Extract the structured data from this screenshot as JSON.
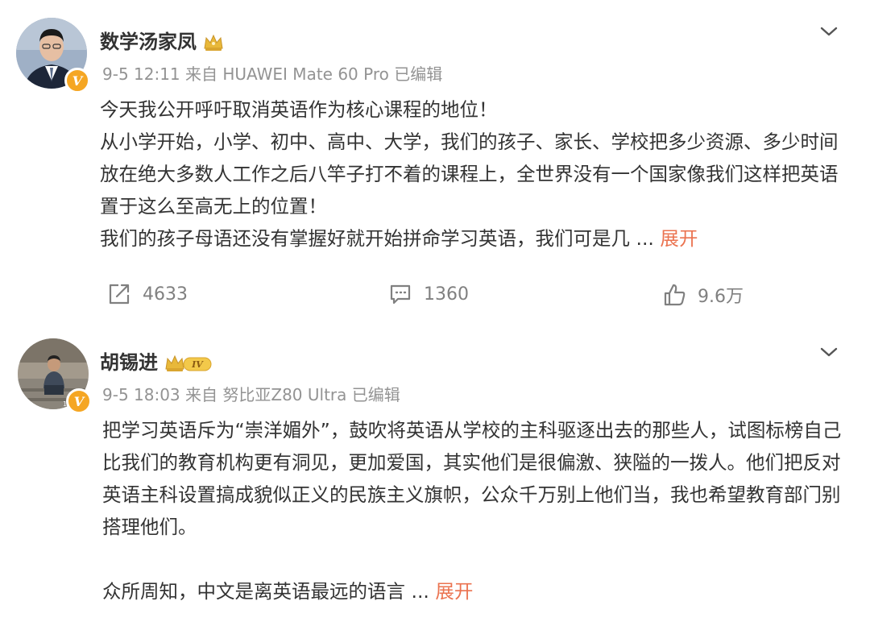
{
  "posts": [
    {
      "author": "数学汤家凤",
      "meta": "9-5 12:11 来自 HUAWEI Mate 60 Pro 已编辑",
      "paragraphs": [
        "今天我公开呼吁取消英语作为核心课程的地位！",
        "从小学开始，小学、初中、高中、大学，我们的孩子、家长、学校把多少资源、多少时间放在绝大多数人工作之后八竿子打不着的课程上，全世界没有一个国家像我们这样把英语置于这么至高无上的位置！",
        "我们的孩子母语还没有掌握好就开始拼命学习英语，我们可是几 ..."
      ],
      "expand_label": "展开",
      "verified_icon": "v-verified-badge",
      "crown_icon": "gold-crown-icon",
      "actions": {
        "repost_count": "4633",
        "comment_count": "1360",
        "like_count": "9.6万"
      }
    },
    {
      "author": "胡锡进",
      "meta": "9-5 18:03 来自 努比亚Z80 Ultra 已编辑",
      "level_badge": "IV",
      "paragraphs": [
        "把学习英语斥为“崇洋媚外”，鼓吹将英语从学校的主科驱逐出去的那些人，试图标榜自己比我们的教育机构更有洞见，更加爱国，其实他们是很偏激、狭隘的一拨人。他们把反对英语主科设置搞成貌似正义的民族主义旗帜，公众千万别上他们当，我也希望教育部门别搭理他们。",
        "众所周知，中文是离英语最远的语言 ..."
      ],
      "expand_label": "展开",
      "verified_icon": "v-verified-badge",
      "crown_icon": "gold-crown-level-icon"
    }
  ],
  "colors": {
    "text": "#333333",
    "meta": "#939393",
    "accent_expand": "#eb7350",
    "verified": "#f5a623",
    "crown": "#e8b83a"
  }
}
